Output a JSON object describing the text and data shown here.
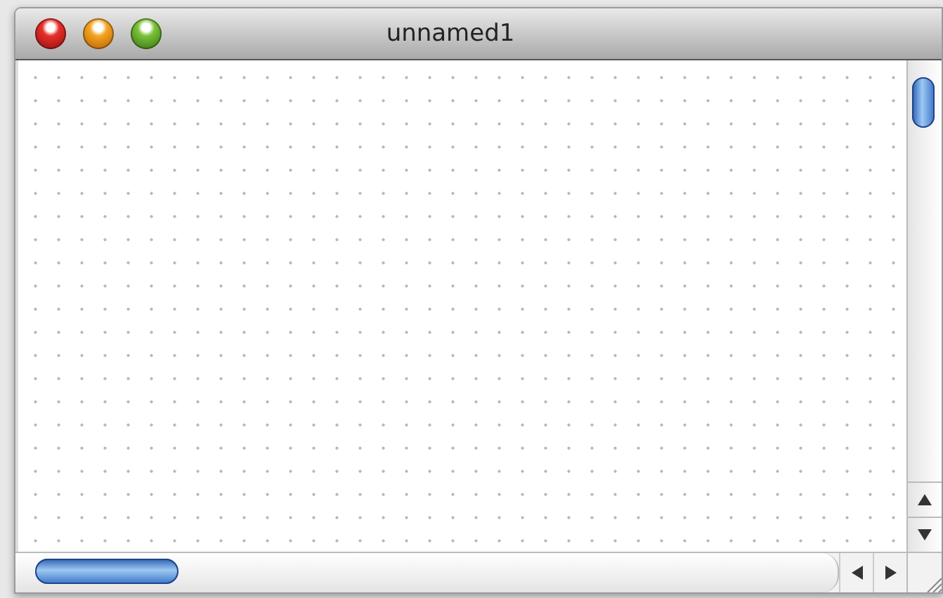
{
  "window": {
    "title": "unnamed1"
  }
}
